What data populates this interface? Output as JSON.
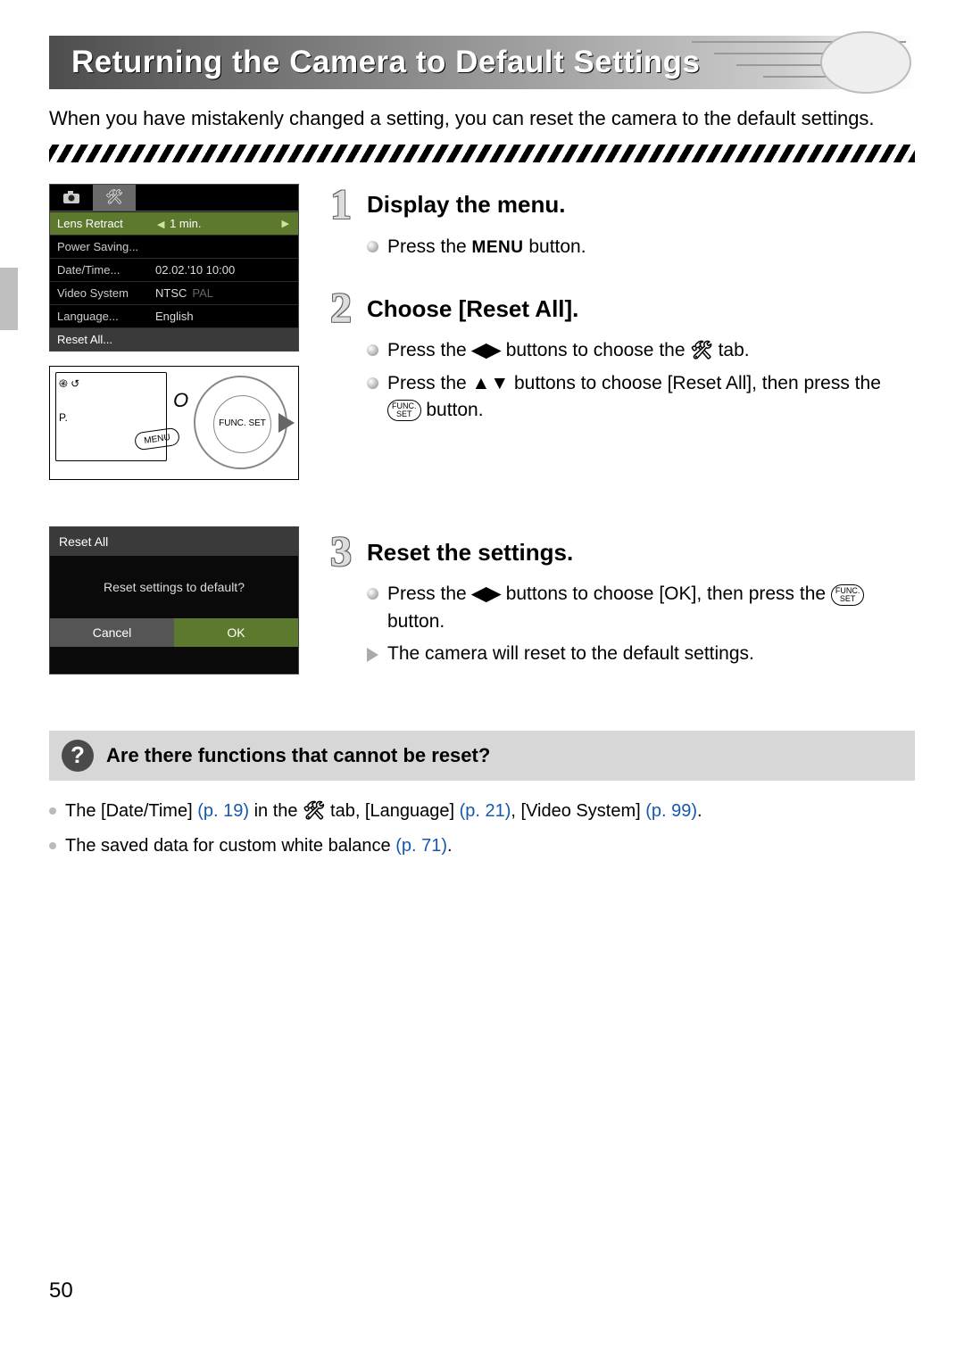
{
  "title": "Returning the Camera to Default Settings",
  "intro": "When you have mistakenly changed a setting, you can reset the camera to the default settings.",
  "page_number": "50",
  "menu_screen": {
    "tab_camera": "camera",
    "tab_tools": "tools",
    "rows": [
      {
        "label": "Lens Retract",
        "value": "1 min."
      },
      {
        "label": "Power Saving",
        "value": ""
      },
      {
        "label": "Date/Time",
        "value": "02.02.'10 10:00"
      },
      {
        "label": "Video System",
        "value": "NTSC",
        "dim": "PAL"
      },
      {
        "label": "Language",
        "value": "English"
      },
      {
        "label": "Reset All",
        "value": ""
      }
    ]
  },
  "camera_back": {
    "menu_btn": "MENU",
    "func_label": "FUNC. SET",
    "off": "O"
  },
  "dialog": {
    "title": "Reset All",
    "message": "Reset settings to default?",
    "cancel": "Cancel",
    "ok": "OK"
  },
  "steps": [
    {
      "num": "1",
      "title": "Display the menu.",
      "lines": [
        {
          "kind": "dot",
          "text_before": "Press the ",
          "btn": "MENU",
          "text_after": " button."
        }
      ]
    },
    {
      "num": "2",
      "title": "Choose [Reset All].",
      "lines": [
        {
          "kind": "dot",
          "text_before": "Press the ",
          "sym": "◀▶",
          "text_after": " buttons to choose the ",
          "tools": true,
          "tail": " tab."
        },
        {
          "kind": "dot",
          "text_before": "Press the ",
          "sym": "▲▼",
          "text_after": " buttons to choose [Reset All], then press the ",
          "func": true,
          "tail": " button."
        }
      ]
    },
    {
      "num": "3",
      "title": "Reset the settings.",
      "lines": [
        {
          "kind": "dot",
          "text_before": "Press the ",
          "sym": "◀▶",
          "text_after": " buttons to choose [OK], then press the ",
          "func": true,
          "tail": " button."
        },
        {
          "kind": "tri",
          "plain": "The camera will reset to the default settings."
        }
      ]
    }
  ],
  "question": {
    "title": "Are there functions that cannot be reset?",
    "items": [
      {
        "segments": [
          {
            "t": "The [Date/Time] "
          },
          {
            "t": "(p. 19)",
            "link": true
          },
          {
            "t": " in the "
          },
          {
            "tools": true
          },
          {
            "t": " tab, [Language] "
          },
          {
            "t": "(p. 21)",
            "link": true
          },
          {
            "t": ", [Video System] "
          },
          {
            "t": "(p. 99)",
            "link": true
          },
          {
            "t": "."
          }
        ]
      },
      {
        "segments": [
          {
            "t": "The saved data for custom white balance "
          },
          {
            "t": "(p. 71)",
            "link": true
          },
          {
            "t": "."
          }
        ]
      }
    ]
  }
}
